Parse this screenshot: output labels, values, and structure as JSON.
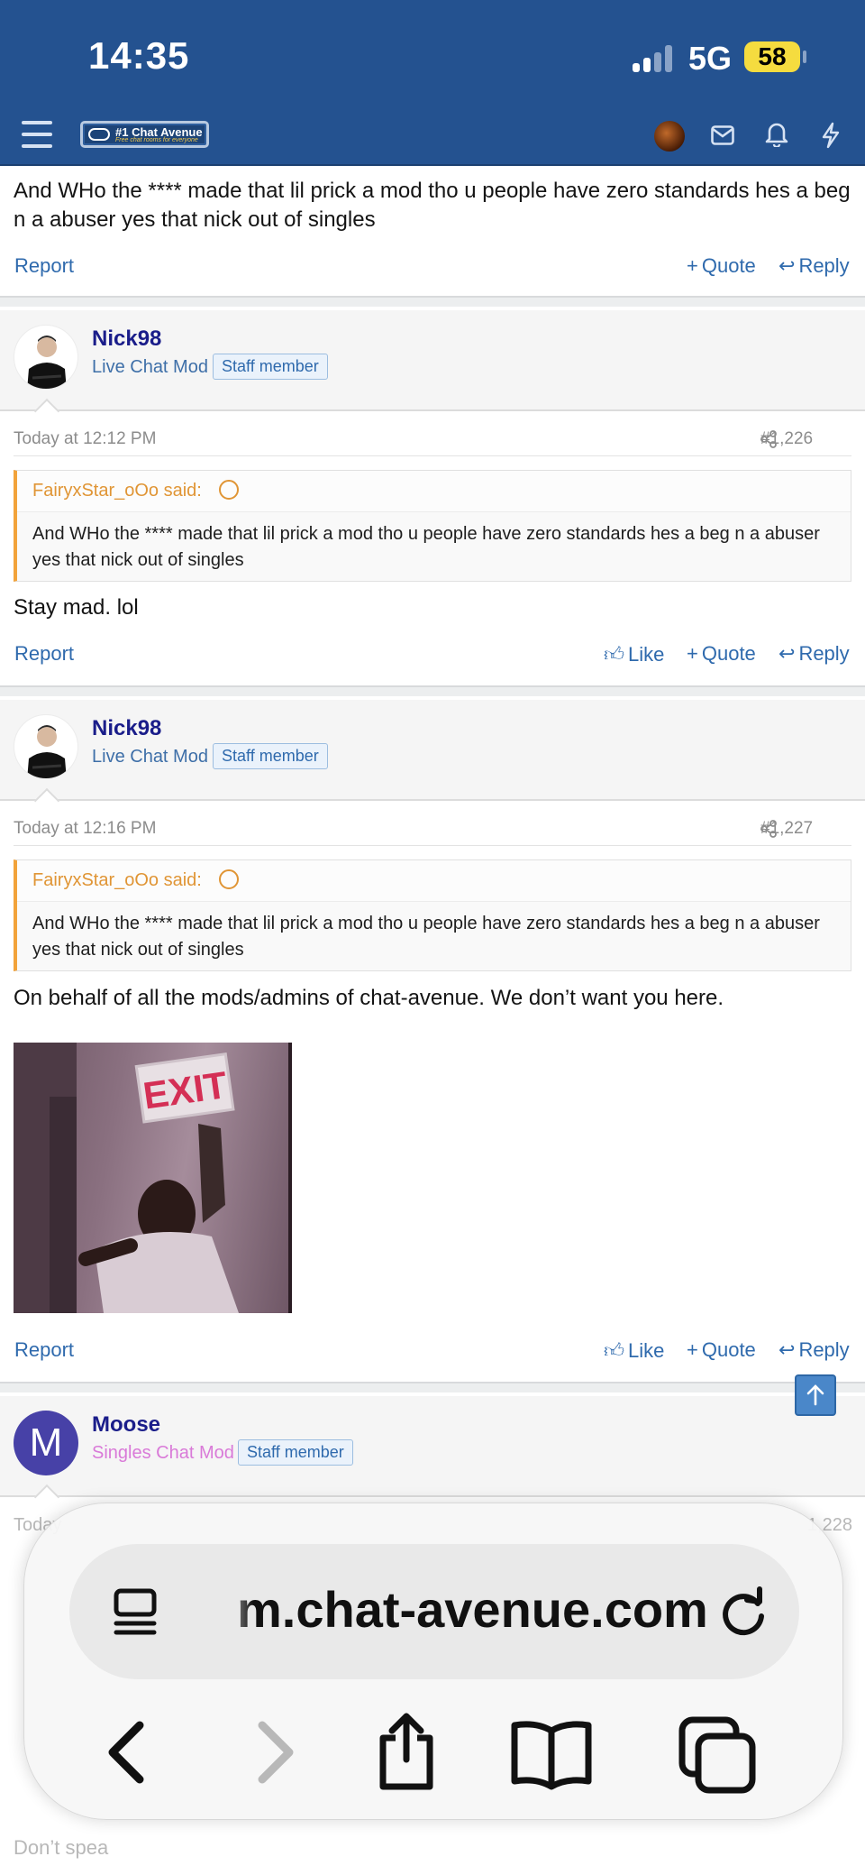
{
  "status_bar": {
    "time": "14:35",
    "network": "5G",
    "battery": "58"
  },
  "nav": {
    "logo_title": "#1 Chat Avenue",
    "logo_subtitle": "Free chat rooms for everyone"
  },
  "top_post": {
    "text": "And WHo the **** made that lil prick a mod tho u people have zero standards hes a beg n a abuser yes that nick out of singles",
    "actions": {
      "report": "Report",
      "quote": "Quote",
      "reply": "Reply"
    }
  },
  "posts": [
    {
      "username": "Nick98",
      "user_title": "Live Chat Mod",
      "staff_badge": "Staff member",
      "timestamp": "Today at 12:12 PM",
      "post_number": "#1,226",
      "quote_author": "FairyxStar_oOo said:",
      "quote_text": "And WHo the **** made that lil prick a mod tho u people have zero standards hes a beg n a abuser yes that nick out of singles",
      "body": "Stay mad. lol",
      "actions": {
        "report": "Report",
        "like": "Like",
        "quote": "Quote",
        "reply": "Reply"
      }
    },
    {
      "username": "Nick98",
      "user_title": "Live Chat Mod",
      "staff_badge": "Staff member",
      "timestamp": "Today at 12:16 PM",
      "post_number": "#1,227",
      "quote_author": "FairyxStar_oOo said:",
      "quote_text": "And WHo the **** made that lil prick a mod tho u people have zero standards hes a beg n a abuser yes that nick out of singles",
      "body": "On behalf of all the mods/admins of chat-avenue. We don’t want you here.",
      "image_sign": "EXIT",
      "actions": {
        "report": "Report",
        "like": "Like",
        "quote": "Quote",
        "reply": "Reply"
      }
    },
    {
      "username": "Moose",
      "avatar_letter": "M",
      "user_title": "Singles Chat Mod",
      "staff_badge": "Staff member",
      "timestamp_partial": "Today",
      "post_number_partial": "1,228",
      "body_partial": "Don’t spea"
    }
  ],
  "browser": {
    "url": "m.chat-avenue.com"
  },
  "colors": {
    "header": "#245290",
    "link": "#2f6aad",
    "quote_accent": "#f2a33a",
    "username": "#1a1d8a"
  }
}
